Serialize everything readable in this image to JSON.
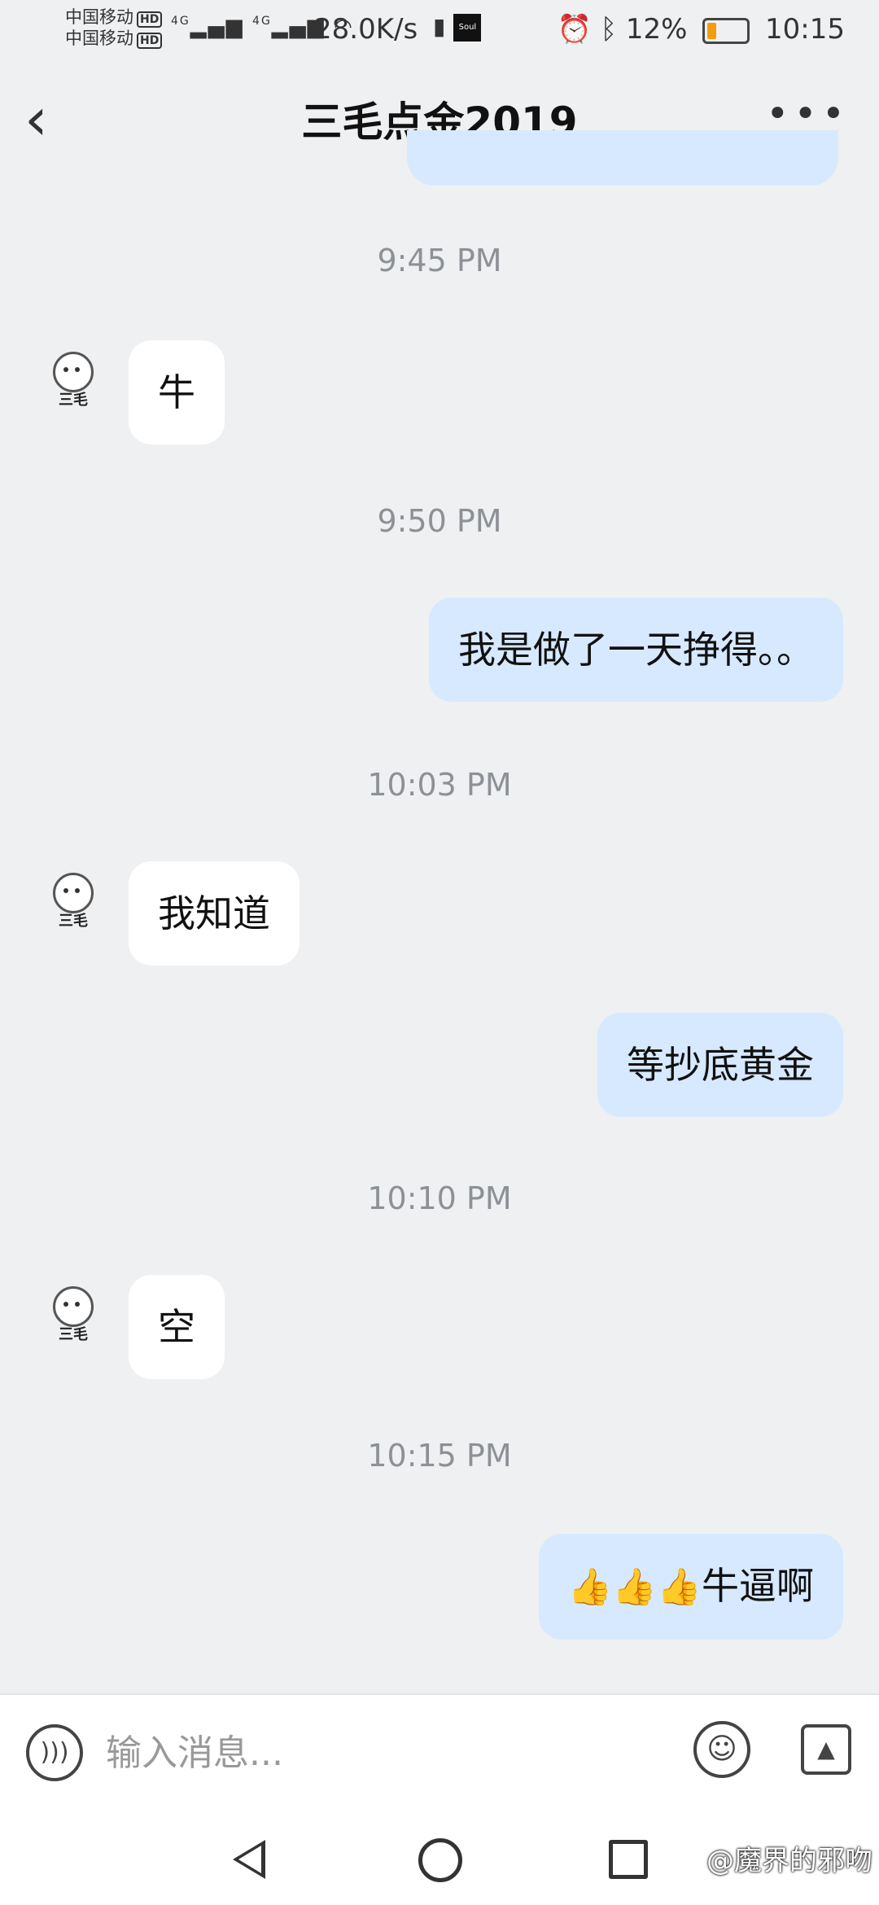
{
  "status_bar": {
    "carrier1": "中国移动",
    "carrier2": "中国移动",
    "hd": "HD",
    "signal1": "4G",
    "signal2": "4G",
    "net_speed": "28.0K/s",
    "soul_label": "Soul",
    "battery_percent": "12%",
    "clock": "10:15",
    "battery_level": 0.12
  },
  "header": {
    "title": "三毛点金2019"
  },
  "avatar_name": "三毛",
  "messages": [
    {
      "time": "9:45 PM"
    },
    {
      "from": "in",
      "text": "牛"
    },
    {
      "time": "9:50 PM"
    },
    {
      "from": "out",
      "text": "我是做了一天挣得。。"
    },
    {
      "time": "10:03 PM"
    },
    {
      "from": "in",
      "text": "我知道"
    },
    {
      "from": "out",
      "text": "等抄底黄金"
    },
    {
      "time": "10:10 PM"
    },
    {
      "from": "in",
      "text": "空"
    },
    {
      "time": "10:15 PM"
    },
    {
      "from": "out",
      "emoji": "👍👍👍",
      "text": "牛逼啊"
    }
  ],
  "input": {
    "placeholder": "输入消息..."
  },
  "watermark": "@魔界的邪吻"
}
